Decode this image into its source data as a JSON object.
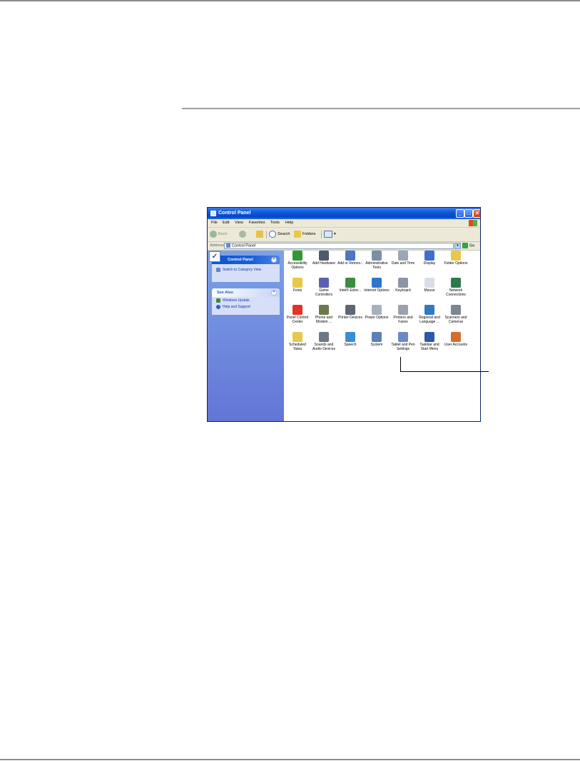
{
  "window": {
    "title": "Control Panel",
    "menu": [
      "File",
      "Edit",
      "View",
      "Favorites",
      "Tools",
      "Help"
    ],
    "toolbar": {
      "back": "Back",
      "search": "Search",
      "folders": "Folders"
    },
    "address": {
      "label": "Address",
      "value": "Control Panel",
      "go": "Go"
    }
  },
  "sidebar": {
    "control_panel": {
      "title": "Control Panel",
      "link": "Switch to Category View"
    },
    "see_also": {
      "title": "See Also",
      "links": [
        "Windows Update",
        "Help and Support"
      ]
    }
  },
  "icons": [
    {
      "label": "Accessibility Options",
      "color": "#2f9a35"
    },
    {
      "label": "Add Hardware",
      "color": "#4c5a6b"
    },
    {
      "label": "Add or Remov...",
      "color": "#4b77c4"
    },
    {
      "label": "Administrative Tools",
      "color": "#7a8ea8"
    },
    {
      "label": "Date and Time",
      "color": "#9aa7b6"
    },
    {
      "label": "Display",
      "color": "#3f6fc7"
    },
    {
      "label": "Folder Options",
      "color": "#e8c84a"
    },
    {
      "label": "Fonts",
      "color": "#e8c84a"
    },
    {
      "label": "Game Controllers",
      "color": "#5a62b0"
    },
    {
      "label": "Intel® Extre...",
      "color": "#3b8d3f"
    },
    {
      "label": "Internet Options",
      "color": "#2f75c9"
    },
    {
      "label": "Keyboard",
      "color": "#8b95a5"
    },
    {
      "label": "Mouse",
      "color": "#d9dde4"
    },
    {
      "label": "Network Connections",
      "color": "#2c7a4c"
    },
    {
      "label": "Panel Control Center",
      "color": "#e2332a"
    },
    {
      "label": "Phone and Modem ...",
      "color": "#6b7a4b"
    },
    {
      "label": "Printer Devices",
      "color": "#5d6673"
    },
    {
      "label": "Power Options",
      "color": "#a5b1c0"
    },
    {
      "label": "Printers and Faxes",
      "color": "#9aa2ad"
    },
    {
      "label": "Regional and Language ...",
      "color": "#2f7ac0"
    },
    {
      "label": "Scanners and Cameras",
      "color": "#7c8796"
    },
    {
      "label": "Scheduled Tasks",
      "color": "#e8c84a"
    },
    {
      "label": "Sounds and Audio Devices",
      "color": "#6e7785"
    },
    {
      "label": "Speech",
      "color": "#3b8dd3"
    },
    {
      "label": "System",
      "color": "#5c7fb8"
    },
    {
      "label": "Tablet and Pen Settings",
      "color": "#6b88c4"
    },
    {
      "label": "Taskbar and Start Menu",
      "color": "#2c59a8"
    },
    {
      "label": "User Accounts",
      "color": "#d76b2d"
    }
  ]
}
